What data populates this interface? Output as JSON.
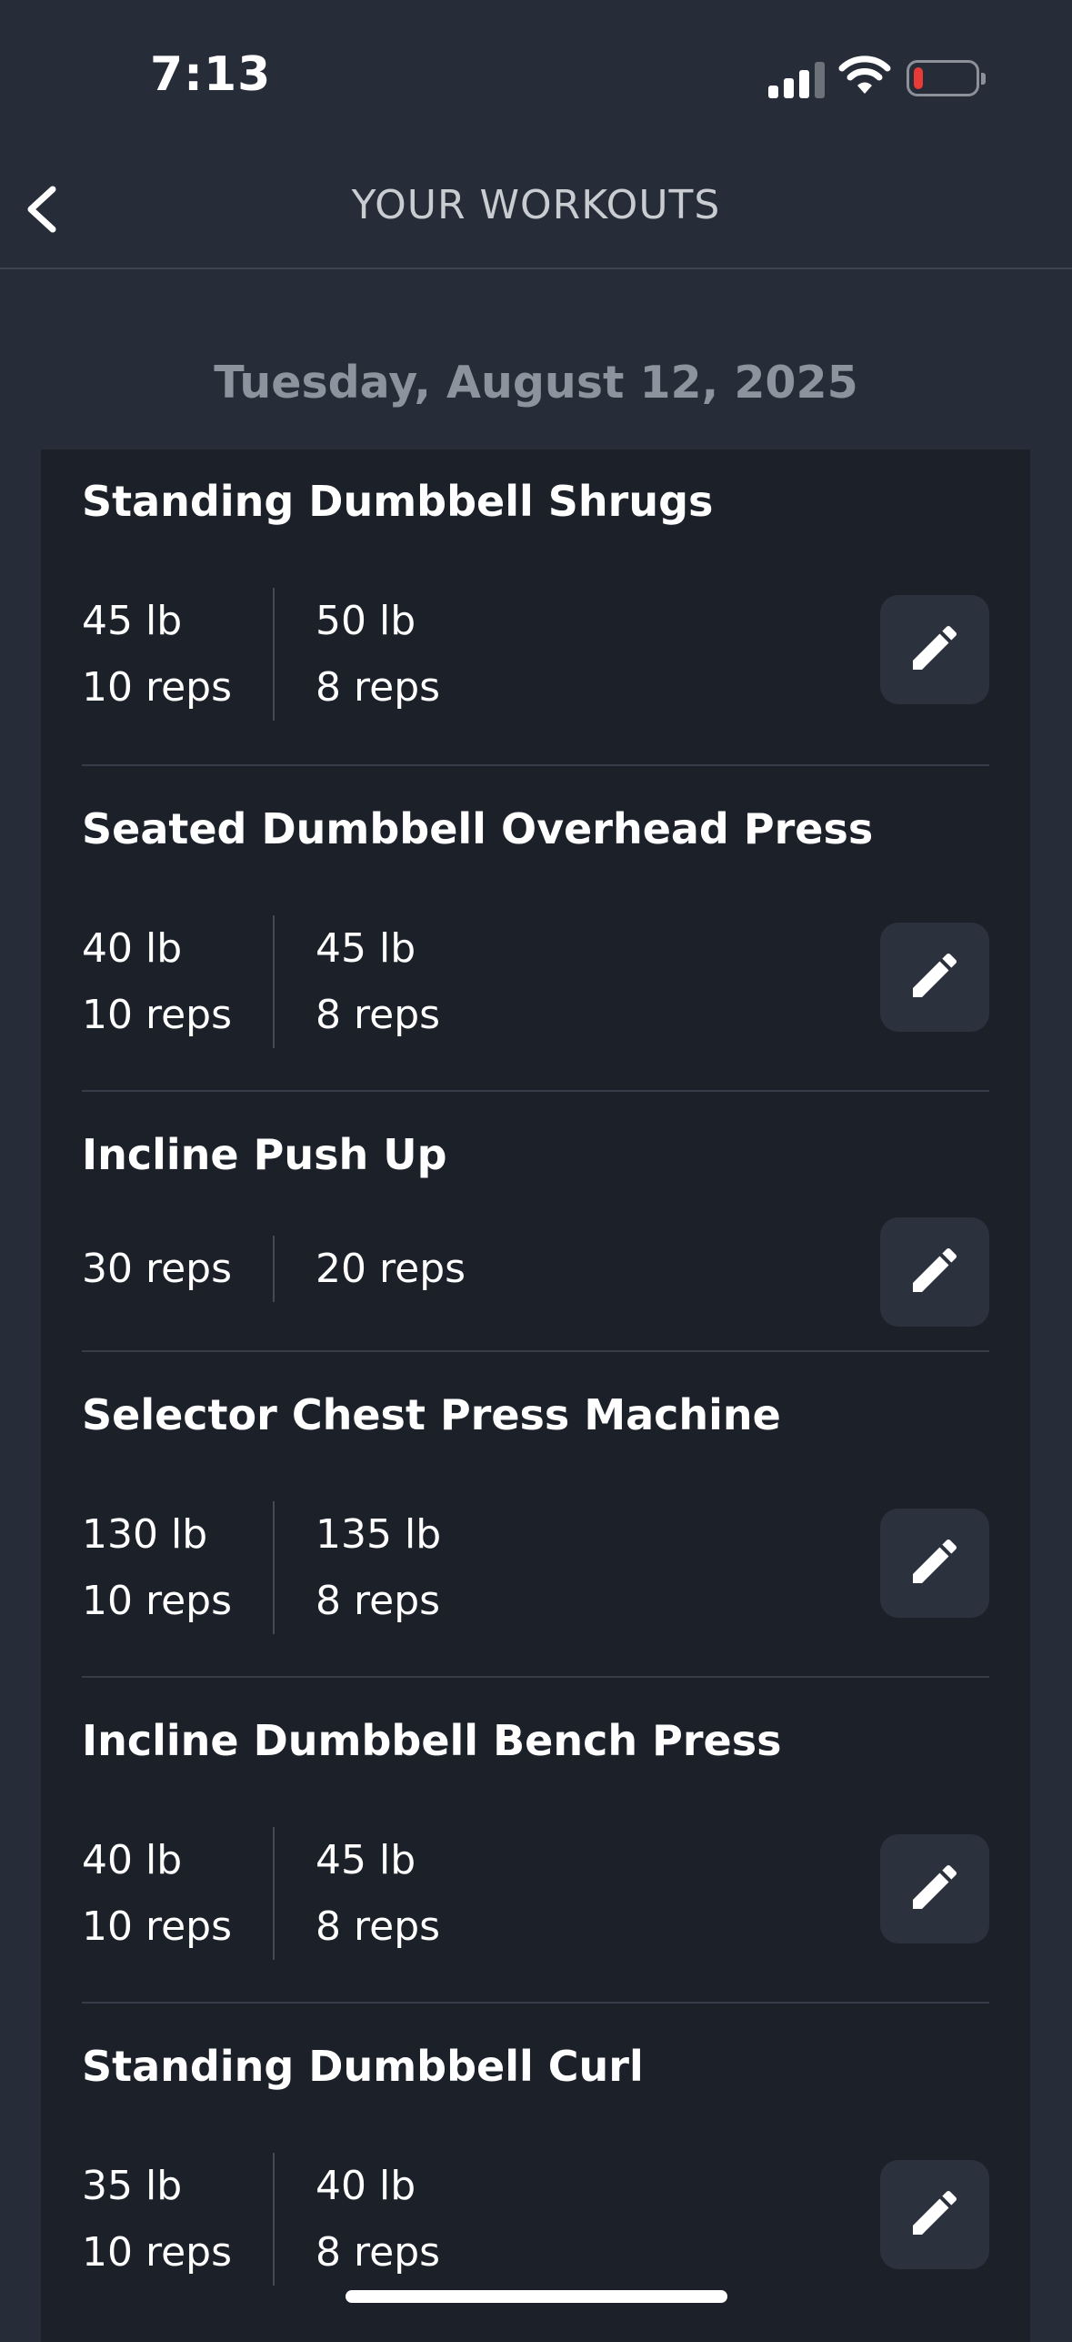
{
  "status_bar": {
    "time": "7:13",
    "battery_level": 0.15
  },
  "nav": {
    "title": "YOUR WORKOUTS",
    "back_icon": "chevron-left-icon"
  },
  "date_header": "Tuesday, August 12, 2025",
  "exercises": [
    {
      "name": "Standing Dumbbell Shrugs",
      "sets": [
        {
          "weight": "45 lb",
          "reps": "10 reps"
        },
        {
          "weight": "50 lb",
          "reps": "8 reps"
        }
      ]
    },
    {
      "name": "Seated Dumbbell Overhead Press",
      "sets": [
        {
          "weight": "40 lb",
          "reps": "10 reps"
        },
        {
          "weight": "45 lb",
          "reps": "8 reps"
        }
      ]
    },
    {
      "name": "Incline Push Up",
      "sets": [
        {
          "reps": "30 reps"
        },
        {
          "reps": "20 reps"
        }
      ]
    },
    {
      "name": "Selector Chest Press Machine",
      "sets": [
        {
          "weight": "130 lb",
          "reps": "10 reps"
        },
        {
          "weight": "135 lb",
          "reps": "8 reps"
        }
      ]
    },
    {
      "name": "Incline Dumbbell Bench Press",
      "sets": [
        {
          "weight": "40 lb",
          "reps": "10 reps"
        },
        {
          "weight": "45 lb",
          "reps": "8 reps"
        }
      ]
    },
    {
      "name": "Standing Dumbbell Curl",
      "sets": [
        {
          "weight": "35 lb",
          "reps": "10 reps"
        },
        {
          "weight": "40 lb",
          "reps": "8 reps"
        }
      ]
    }
  ],
  "icons": {
    "edit": "pencil-icon"
  },
  "colors": {
    "background": "#262d38",
    "card": "#1b2029",
    "edit_button": "#2b323d",
    "battery_low": "#e83a36"
  }
}
